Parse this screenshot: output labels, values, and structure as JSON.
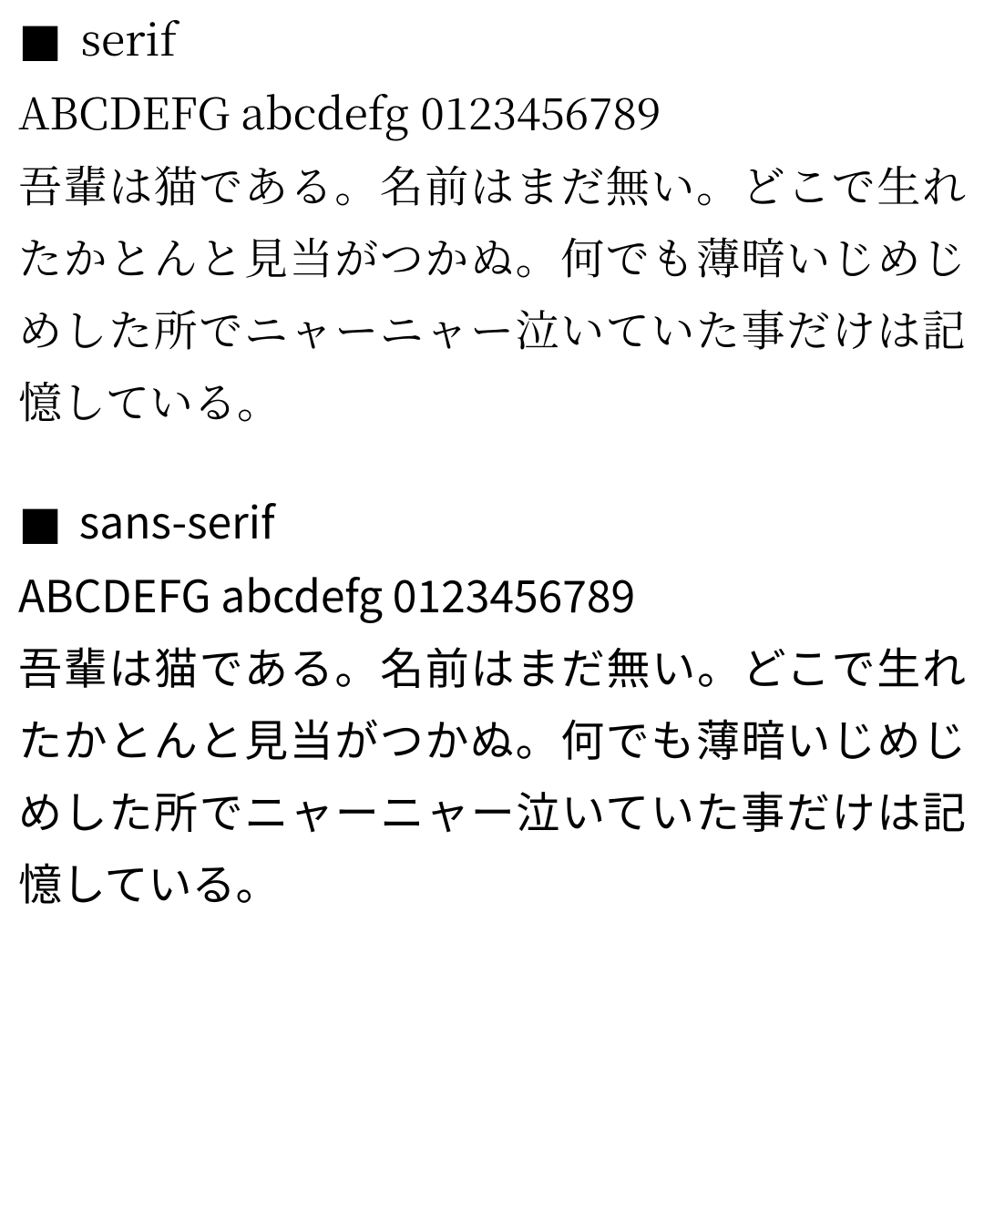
{
  "sections": [
    {
      "bullet": "■",
      "heading": "serif",
      "latin_sample": "ABCDEFG abcdefg 0123456789",
      "japanese_sample": "吾輩は猫である。名前はまだ無い。どこで生れたかとんと見当がつかぬ。何でも薄暗いじめじめした所でニャーニャー泣いていた事だけは記憶している。"
    },
    {
      "bullet": "■",
      "heading": "sans-serif",
      "latin_sample": "ABCDEFG abcdefg 0123456789",
      "japanese_sample": "吾輩は猫である。名前はまだ無い。どこで生れたかとんと見当がつかぬ。何でも薄暗いじめじめした所でニャーニャー泣いていた事だけは記憶している。"
    }
  ]
}
